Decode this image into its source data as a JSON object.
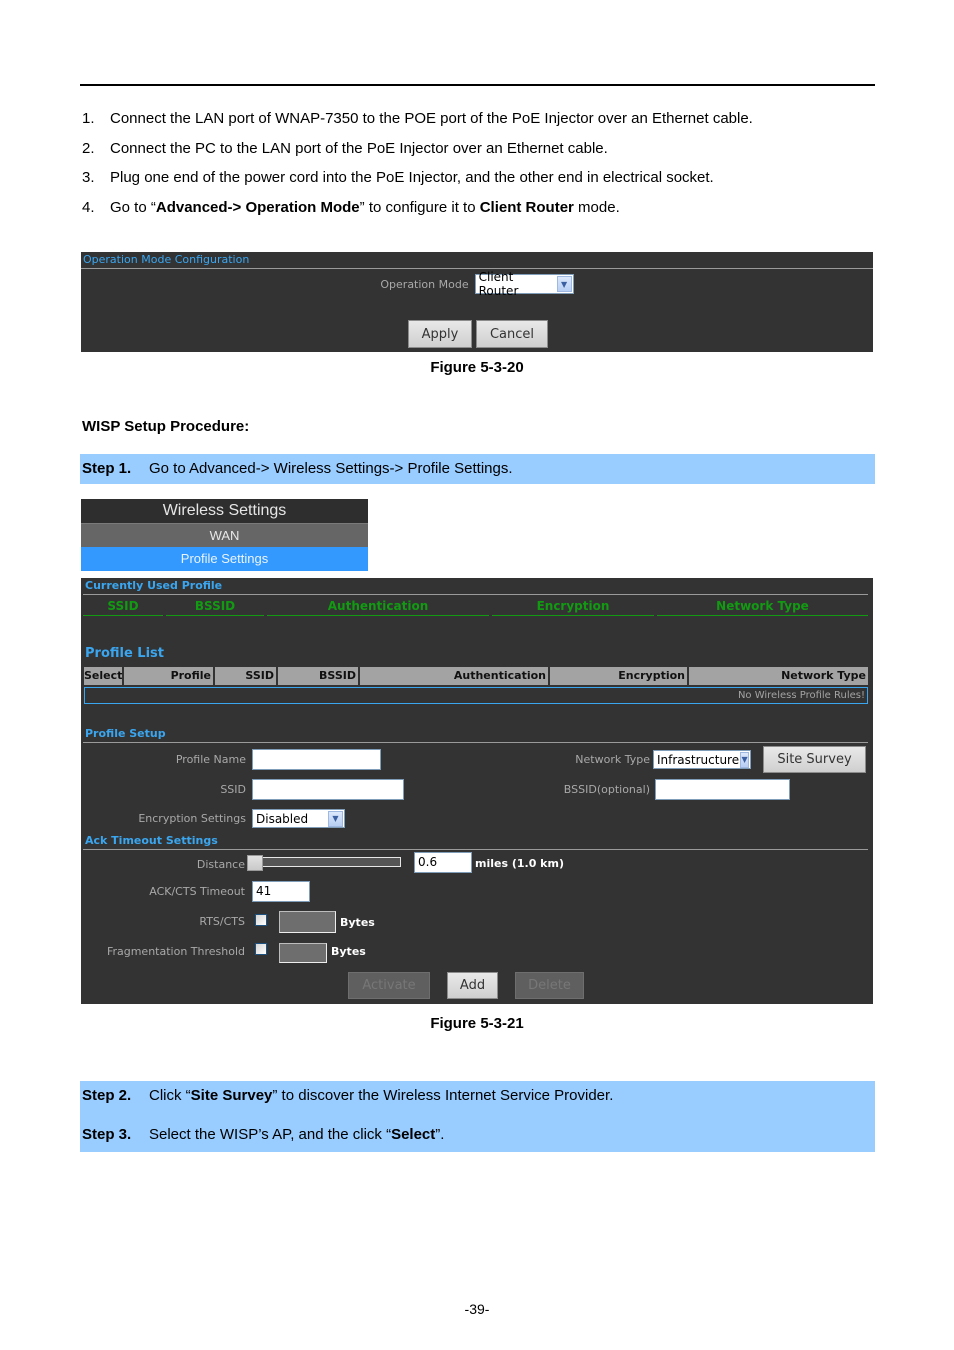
{
  "instructions": [
    {
      "num": "1.",
      "parts": [
        {
          "t": "Connect the LAN port of WNAP-7350 to the POE port of the PoE Injector over an Ethernet cable.",
          "b": false
        }
      ]
    },
    {
      "num": "2.",
      "parts": [
        {
          "t": "Connect the PC to the LAN port of the PoE Injector over an Ethernet cable.",
          "b": false
        }
      ]
    },
    {
      "num": "3.",
      "parts": [
        {
          "t": "Plug one end of the power cord into the PoE Injector, and the other end in electrical socket.",
          "b": false
        }
      ]
    },
    {
      "num": "4.",
      "parts": [
        {
          "t": "Go to “",
          "b": false
        },
        {
          "t": "Advanced-> Operation Mode",
          "b": true
        },
        {
          "t": "” to configure it to ",
          "b": false
        },
        {
          "t": "Client Router",
          "b": true
        },
        {
          "t": " mode.",
          "b": false
        }
      ]
    }
  ],
  "figure1": {
    "panel_title": "Operation Mode Configuration",
    "operation_mode_label": "Operation Mode",
    "operation_mode_value": "Client Router",
    "apply_label": "Apply",
    "cancel_label": "Cancel",
    "caption": "Figure 5-3-20"
  },
  "wisp_heading": "WISP Setup Procedure:",
  "step1": {
    "label": "Step 1.",
    "text": "Go to Advanced-> Wireless Settings-> Profile Settings."
  },
  "wireless_menu": {
    "title": "Wireless Settings",
    "items": [
      "WAN",
      "Profile Settings"
    ],
    "active": "Profile Settings"
  },
  "figure2": {
    "current_profile": {
      "title": "Currently Used Profile",
      "columns": [
        "SSID",
        "BSSID",
        "Authentication",
        "Encryption",
        "Network Type"
      ]
    },
    "profile_list": {
      "title": "Profile List",
      "columns": [
        "Select",
        "Profile",
        "SSID",
        "BSSID",
        "Authentication",
        "Encryption",
        "Network Type"
      ],
      "empty_message": "No Wireless Profile Rules!"
    },
    "profile_setup": {
      "title": "Profile Setup",
      "profile_name_label": "Profile Name",
      "profile_name_value": "",
      "ssid_label": "SSID",
      "ssid_value": "",
      "encryption_label": "Encryption Settings",
      "encryption_value": "Disabled",
      "network_type_label": "Network Type",
      "network_type_value": "Infrastructure",
      "site_survey_label": "Site Survey",
      "bssid_label": "BSSID(optional)",
      "bssid_value": ""
    },
    "ack_timeout": {
      "title": "Ack Timeout Settings",
      "distance_label": "Distance",
      "distance_value": "0.6",
      "distance_slider_fraction": 0.0,
      "distance_unit": "miles (1.0 km)",
      "ack_cts_label": "ACK/CTS Timeout",
      "ack_cts_value": "41",
      "rts_cts_label": "RTS/CTS",
      "rts_cts_checked": false,
      "rts_cts_unit": "Bytes",
      "frag_label": "Fragmentation Threshold",
      "frag_checked": false,
      "frag_unit": "Bytes"
    },
    "buttons": {
      "activate": "Activate",
      "add": "Add",
      "delete": "Delete"
    },
    "caption": "Figure 5-3-21"
  },
  "step2": {
    "label": "Step 2.",
    "parts": [
      {
        "t": "Click “",
        "b": false
      },
      {
        "t": "Site Survey",
        "b": true
      },
      {
        "t": "” to discover the Wireless Internet Service Provider.",
        "b": false
      }
    ]
  },
  "step3": {
    "label": "Step 3.",
    "parts": [
      {
        "t": "Select the WISP’s AP, and the click “",
        "b": false
      },
      {
        "t": "Select",
        "b": true
      },
      {
        "t": "”.",
        "b": false
      }
    ]
  },
  "page_number": "-39-"
}
